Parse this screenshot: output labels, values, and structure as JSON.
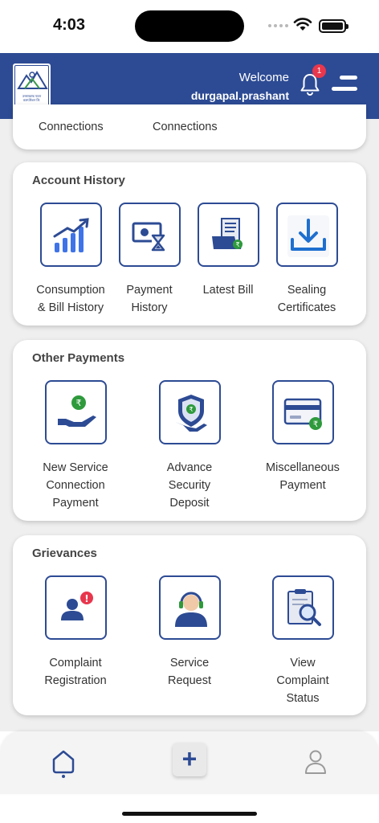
{
  "status_bar": {
    "time": "4:03"
  },
  "header": {
    "logo_text": "उत्तराखण्ड पावर कारपोरेशन लि.",
    "welcome": "Welcome",
    "username": "durgapal.prashant",
    "notification_count": "1"
  },
  "connections_card": {
    "labels": [
      "Connections",
      "Connections"
    ]
  },
  "account_history": {
    "title": "Account History",
    "items": [
      {
        "line1": "Consumption",
        "line2": "& Bill History",
        "icon": "bar-chart-growth-icon"
      },
      {
        "line1": "Payment",
        "line2": "History",
        "icon": "cash-hourglass-icon"
      },
      {
        "line1": "Latest Bill",
        "line2": "",
        "icon": "bill-receipt-icon"
      },
      {
        "line1": "Sealing",
        "line2": "Certificates",
        "icon": "download-icon"
      }
    ]
  },
  "other_payments": {
    "title": "Other Payments",
    "items": [
      {
        "line1": "New Service",
        "line2": "Connection",
        "line3": "Payment",
        "icon": "hand-rupee-icon"
      },
      {
        "line1": "Advance",
        "line2": "Security",
        "line3": "Deposit",
        "icon": "shield-rupee-icon"
      },
      {
        "line1": "Miscellaneous",
        "line2": "Payment",
        "line3": "",
        "icon": "card-rupee-icon"
      }
    ]
  },
  "grievances": {
    "title": "Grievances",
    "items": [
      {
        "line1": "Complaint",
        "line2": "Registration",
        "line3": "",
        "icon": "user-alert-icon"
      },
      {
        "line1": "Service",
        "line2": "Request",
        "line3": "",
        "icon": "headset-agent-icon"
      },
      {
        "line1": "View",
        "line2": "Complaint",
        "line3": "Status",
        "icon": "clipboard-search-icon"
      }
    ]
  },
  "bottom_nav": {
    "items": [
      "home-icon",
      "plus-icon",
      "profile-icon"
    ],
    "plus_symbol": "+"
  },
  "colors": {
    "brand": "#2d4b94",
    "badge": "#e8374d",
    "rupee_green": "#2e9a3c"
  }
}
